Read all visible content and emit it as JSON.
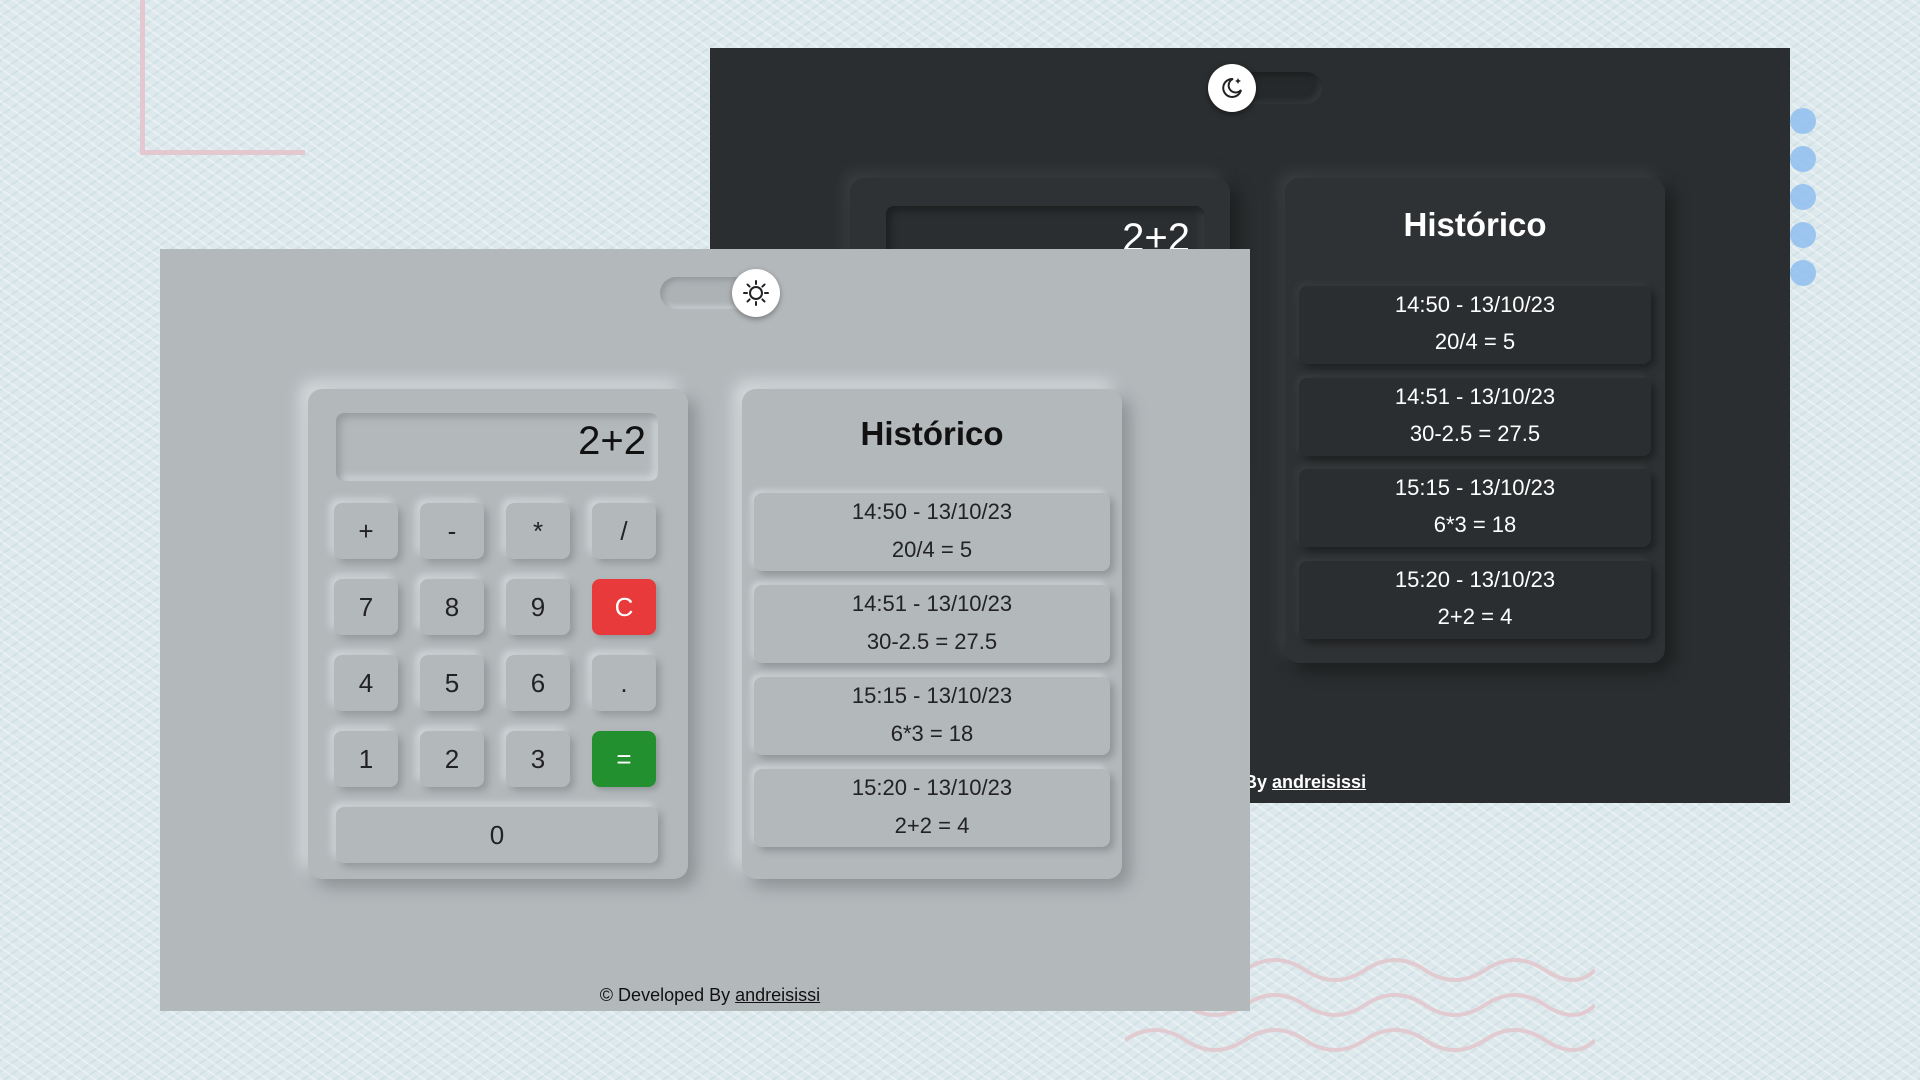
{
  "dark_window": {
    "display_value": "2+2",
    "history_title": "Histórico",
    "history_entries": [
      {
        "time": "14:50 - 13/10/23",
        "expr": "20/4 = 5"
      },
      {
        "time": "14:51 - 13/10/23",
        "expr": "30-2.5 = 27.5"
      },
      {
        "time": "15:15 - 13/10/23",
        "expr": "6*3 = 18"
      },
      {
        "time": "15:20 - 13/10/23",
        "expr": "2+2 = 4"
      }
    ],
    "footer_visible_text": "d By ",
    "footer_author": "andreisissi",
    "theme_icon": "moon-icon",
    "background": "#2b2e30"
  },
  "light_window": {
    "display_value": "2+2",
    "keys": {
      "plus": "+",
      "minus": "-",
      "multiply": "*",
      "divide": "/",
      "seven": "7",
      "eight": "8",
      "nine": "9",
      "clear": "C",
      "four": "4",
      "five": "5",
      "six": "6",
      "dot": ".",
      "one": "1",
      "two": "2",
      "three": "3",
      "equals": "=",
      "zero": "0"
    },
    "history_title": "Histórico",
    "history_entries": [
      {
        "time": "14:50 - 13/10/23",
        "expr": "20/4 = 5"
      },
      {
        "time": "14:51 - 13/10/23",
        "expr": "30-2.5 = 27.5"
      },
      {
        "time": "15:15 - 13/10/23",
        "expr": "6*3 = 18"
      },
      {
        "time": "15:20 - 13/10/23",
        "expr": "2+2 = 4"
      }
    ],
    "footer_text": "© Developed By ",
    "footer_author": "andreisissi",
    "theme_icon": "sun-icon",
    "background": "#b3b8bb",
    "accent_clear": "#e83a3a",
    "accent_equals": "#23902f"
  }
}
